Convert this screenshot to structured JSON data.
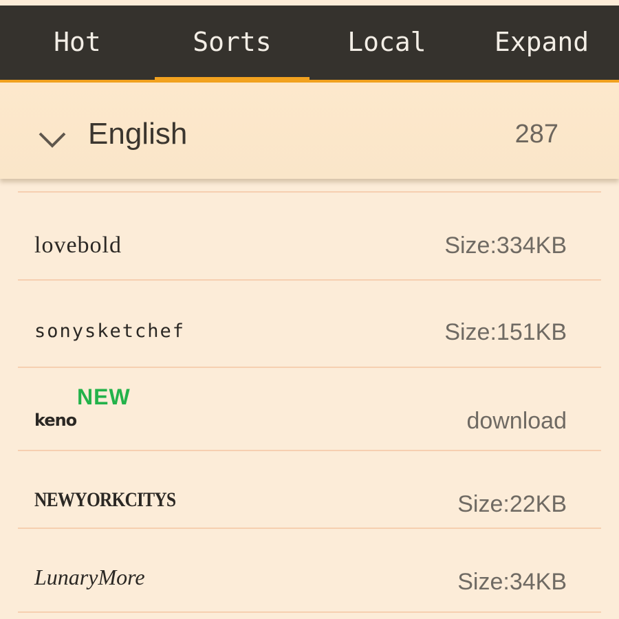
{
  "tabs": [
    {
      "label": "Hot",
      "active": false
    },
    {
      "label": "Sorts",
      "active": true
    },
    {
      "label": "Local",
      "active": false
    },
    {
      "label": "Expand",
      "active": false
    }
  ],
  "group": {
    "title": "English",
    "count": "287",
    "icon": "chevron-down-icon"
  },
  "fonts": [
    {
      "name": "lovebold",
      "right": "Size:334KB"
    },
    {
      "name": "sonysketchef",
      "right": "Size:151KB"
    },
    {
      "name": "keno",
      "badge": "NEW",
      "right": "download"
    },
    {
      "name": "NEWYORKCITYS",
      "right": "Size:22KB"
    },
    {
      "name": "LunaryMore",
      "right": "Size:34KB"
    }
  ],
  "colors": {
    "tabbar": "#35322d",
    "accent": "#f2a21f",
    "background": "#fcecd8",
    "new_badge": "#23b24a"
  }
}
